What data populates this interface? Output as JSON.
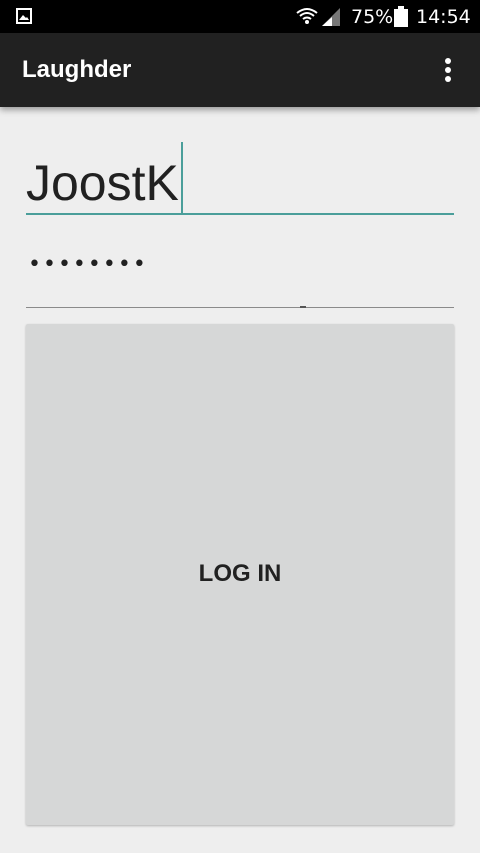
{
  "status_bar": {
    "battery_percent": "75%",
    "time": "14:54",
    "icons": [
      "gallery-icon",
      "wifi-icon",
      "signal-icon",
      "battery-icon"
    ]
  },
  "app_bar": {
    "title": "Laughder",
    "overflow_icon": "more-vert-icon"
  },
  "login_form": {
    "username_value": "JoostK",
    "password_masked": "••••••••",
    "login_button_label": "LOG IN"
  },
  "colors": {
    "app_bar": "#212121",
    "accent": "#4a9e9a",
    "background": "#eeeeee",
    "button": "#d6d7d7"
  }
}
